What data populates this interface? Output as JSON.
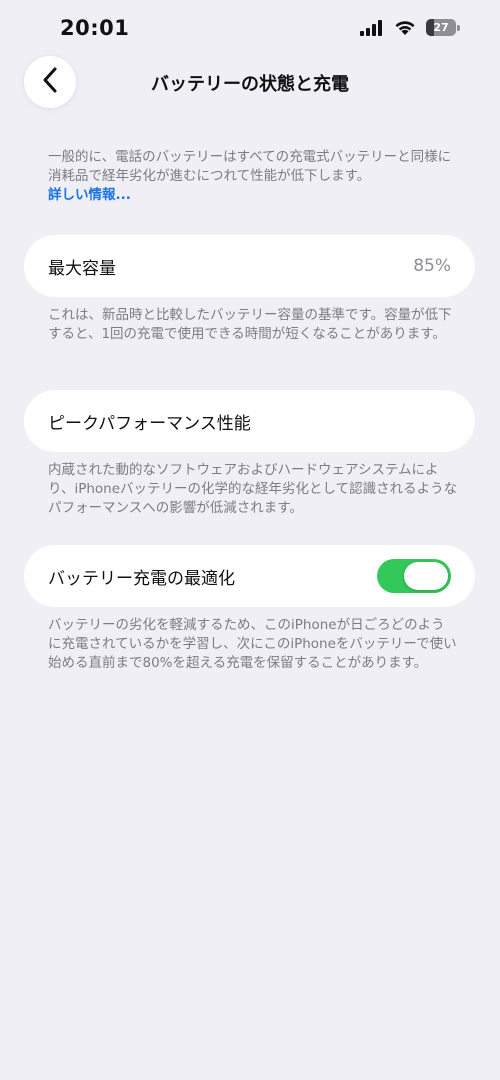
{
  "status_bar": {
    "time": "20:01",
    "battery_level": "27",
    "battery_fill_percent": 27,
    "icons": [
      "signal-icon",
      "wifi-icon",
      "battery-icon"
    ]
  },
  "nav": {
    "title": "バッテリーの状態と充電",
    "back_icon": "chevron-left-icon"
  },
  "intro": {
    "text": "一般的に、電話のバッテリーはすべての充電式バッテリーと同様に消耗品で経年劣化が進むにつれて性能が低下します。",
    "link": "詳しい情報..."
  },
  "max_capacity": {
    "label": "最大容量",
    "value": "85%",
    "description": "これは、新品時と比較したバッテリー容量の基準です。容量が低下すると、1回の充電で使用できる時間が短くなることがあります。"
  },
  "peak_performance": {
    "label": "ピークパフォーマンス性能",
    "description": "内蔵された動的なソフトウェアおよびハードウェアシステムにより、iPhoneバッテリーの化学的な経年劣化として認識されるようなパフォーマンスへの影響が低減されます。"
  },
  "optimized_charging": {
    "label": "バッテリー充電の最適化",
    "enabled": true,
    "description": "バッテリーの劣化を軽減するため、このiPhoneが日ごろどのように充電されているかを学習し、次にこのiPhoneをバッテリーで使い始める直前まで80%を超える充電を保留することがあります。"
  },
  "colors": {
    "background": "#f0eff5",
    "card": "#ffffff",
    "toggle_on": "#34c759",
    "link": "#1a73e8",
    "secondary_text": "#7c7c82"
  }
}
